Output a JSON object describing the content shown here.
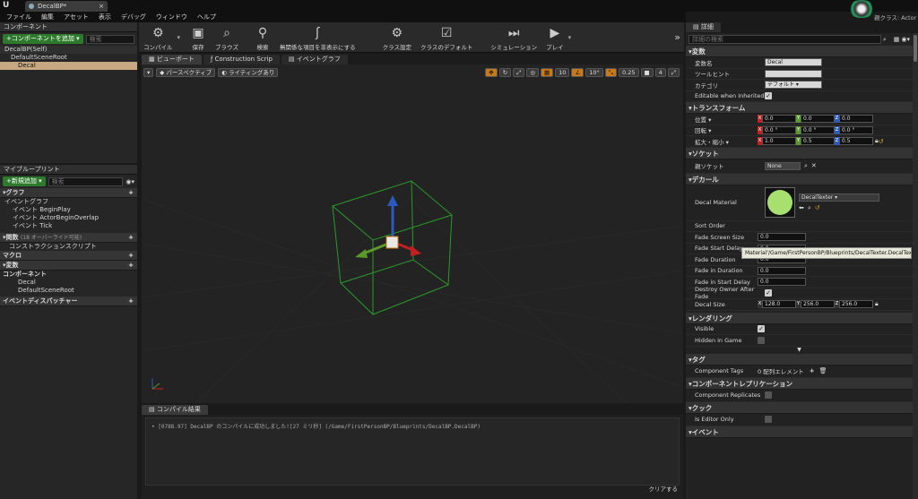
{
  "window": {
    "tab_title": "DecalBP*",
    "tab_close": "×",
    "parent_class": "親クラス: Actor"
  },
  "menu": [
    "ファイル",
    "編集",
    "アセット",
    "表示",
    "デバッグ",
    "ウィンドウ",
    "ヘルプ"
  ],
  "components_panel": {
    "tab": "コンポーネント",
    "add_button": "+コンポーネントを追加 ▾",
    "search_placeholder": "検索",
    "self": "DecalBP(Self)",
    "items": [
      "DefaultSceneRoot",
      "Decal"
    ]
  },
  "myblueprint": {
    "tab": "マイブループリント",
    "add_button": "+新規追加 ▾",
    "search_placeholder": "検索",
    "graph_header": "グラフ",
    "event_graph": "イベントグラフ",
    "events": [
      "イベント BeginPlay",
      "イベント ActorBeginOverlap",
      "イベント Tick"
    ],
    "functions_header": "関数",
    "functions_note": "(18 オーバーライド可能)",
    "construction_script": "コンストラクションスクリプト",
    "macros_header": "マクロ",
    "vars_header": "変数",
    "components_header": "コンポーネント",
    "component_vars": [
      "Decal",
      "DefaultSceneRoot"
    ],
    "dispatchers_header": "イベントディスパッチャー"
  },
  "toolbar": [
    {
      "label": "コンパイル",
      "icon": "compile-icon"
    },
    {
      "label": "保存",
      "icon": "save-icon"
    },
    {
      "label": "ブラウズ",
      "icon": "browse-icon"
    },
    {
      "label": "検索",
      "icon": "find-icon"
    },
    {
      "label": "無関係な項目を非表示にする",
      "icon": "hide-unrelated-icon"
    },
    {
      "label": "クラス設定",
      "icon": "class-settings-icon"
    },
    {
      "label": "クラスのデフォルト",
      "icon": "class-defaults-icon"
    },
    {
      "label": "シミュレーション",
      "icon": "simulation-icon"
    },
    {
      "label": "プレイ",
      "icon": "play-icon"
    }
  ],
  "editor_tabs": [
    "ビューポート",
    "Construction Scrip",
    "イベントグラフ"
  ],
  "viewport": {
    "perspective": "パースペクティブ",
    "lighting": "ライティングあり",
    "grid_snap": "10",
    "rot_snap": "10°",
    "scale_snap": "0.25",
    "camera_speed": "4"
  },
  "compile_results": {
    "tab": "コンパイル結果",
    "message": "[0788.97] DecalBP のコンパイルに成功しました![27 ミリ秒] (/Game/FirstPersonBP/Blueprints/DecalBP.DecalBP)",
    "clear": "クリアする"
  },
  "details": {
    "tab": "詳細",
    "search_placeholder": "詳細の検索",
    "variable_header": "変数",
    "var_name_label": "変数名",
    "var_name": "Decal",
    "tooltip_label": "ツールヒント",
    "category_label": "カテゴリ",
    "category": "デフォルト",
    "editable_label": "Editable when Inherited",
    "transform_header": "トランスフォーム",
    "location_label": "位置 ▾",
    "location": [
      "0.0",
      "0.0",
      "0.0"
    ],
    "rotation_label": "回転 ▾",
    "rotation": [
      "0.0 °",
      "0.0 °",
      "0.0 °"
    ],
    "scale_label": "拡大・縮小 ▾",
    "scale": [
      "1.0",
      "0.5",
      "0.5"
    ],
    "socket_header": "ソケット",
    "parent_socket_label": "親ソケット",
    "parent_socket": "None",
    "decal_header": "デカール",
    "decal_material_label": "Decal Material",
    "decal_material": "DecalTexter",
    "sort_order_label": "Sort Order",
    "tooltip_path": "Material'/Game/FirstPersonBP/Blueprints/DecalTexter.DecalTexter'",
    "fade_rows": [
      {
        "label": "Fade Screen Size",
        "value": "0.0"
      },
      {
        "label": "Fade Start Delay",
        "value": "0.0"
      },
      {
        "label": "Fade Duration",
        "value": "0.0"
      },
      {
        "label": "Fade in Duration",
        "value": "0.0"
      },
      {
        "label": "Fade in Start Delay",
        "value": "0.0"
      }
    ],
    "destroy_label": "Destroy Owner After Fade",
    "decal_size_label": "Decal Size",
    "decal_size": [
      "128.0",
      "256.0",
      "256.0"
    ],
    "rendering_header": "レンダリング",
    "visible_label": "Visible",
    "hidden_label": "Hidden in Game",
    "tags_header": "タグ",
    "component_tags_label": "Component Tags",
    "component_tags": "0 配列エレメント",
    "replication_header": "コンポーネントレプリケーション",
    "replicates_label": "Component Replicates",
    "cook_header": "クック",
    "editor_only_label": "Is Editor Only",
    "events_header": "イベント"
  },
  "colors": {
    "accent_green": "#2d7a2d",
    "x_axis": "#c02020",
    "y_axis": "#5a9a2a",
    "z_axis": "#2a5ac0",
    "bounds": "#2a9a2a"
  }
}
